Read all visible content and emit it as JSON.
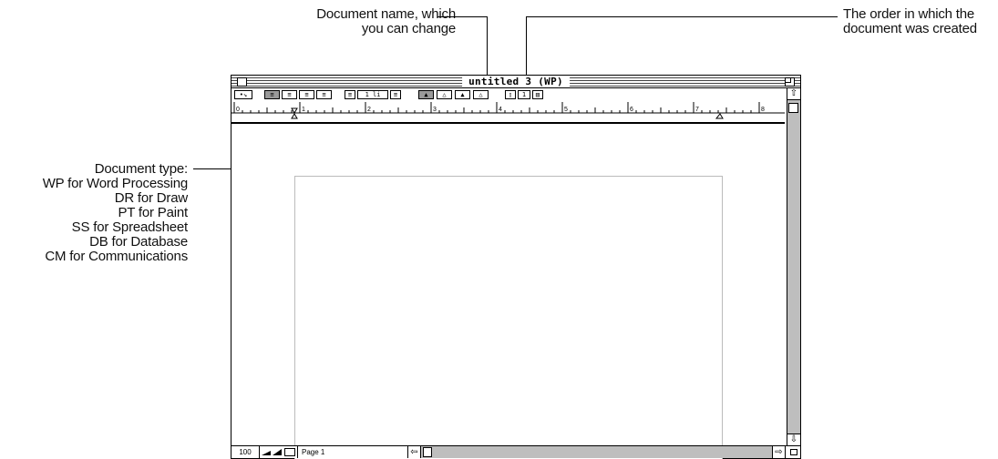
{
  "callouts": {
    "document_name": [
      "Document name, which",
      "you can change"
    ],
    "creation_order": [
      "The order in which the",
      "document was created"
    ],
    "document_type": [
      "Document type:",
      "WP for Word Processing",
      "DR for Draw",
      "PT for Paint",
      "SS for Spreadsheet",
      "DB for Database",
      "CM for Communications"
    ]
  },
  "window": {
    "title": "untitled 3 (WP)"
  },
  "toolbar": {
    "line_spacing": "1 li",
    "column_count": "1"
  },
  "ruler": {
    "labels": [
      "0",
      "1",
      "2",
      "3",
      "4",
      "5",
      "6",
      "7",
      "8"
    ]
  },
  "status": {
    "zoom": "100",
    "page": "Page 1"
  }
}
